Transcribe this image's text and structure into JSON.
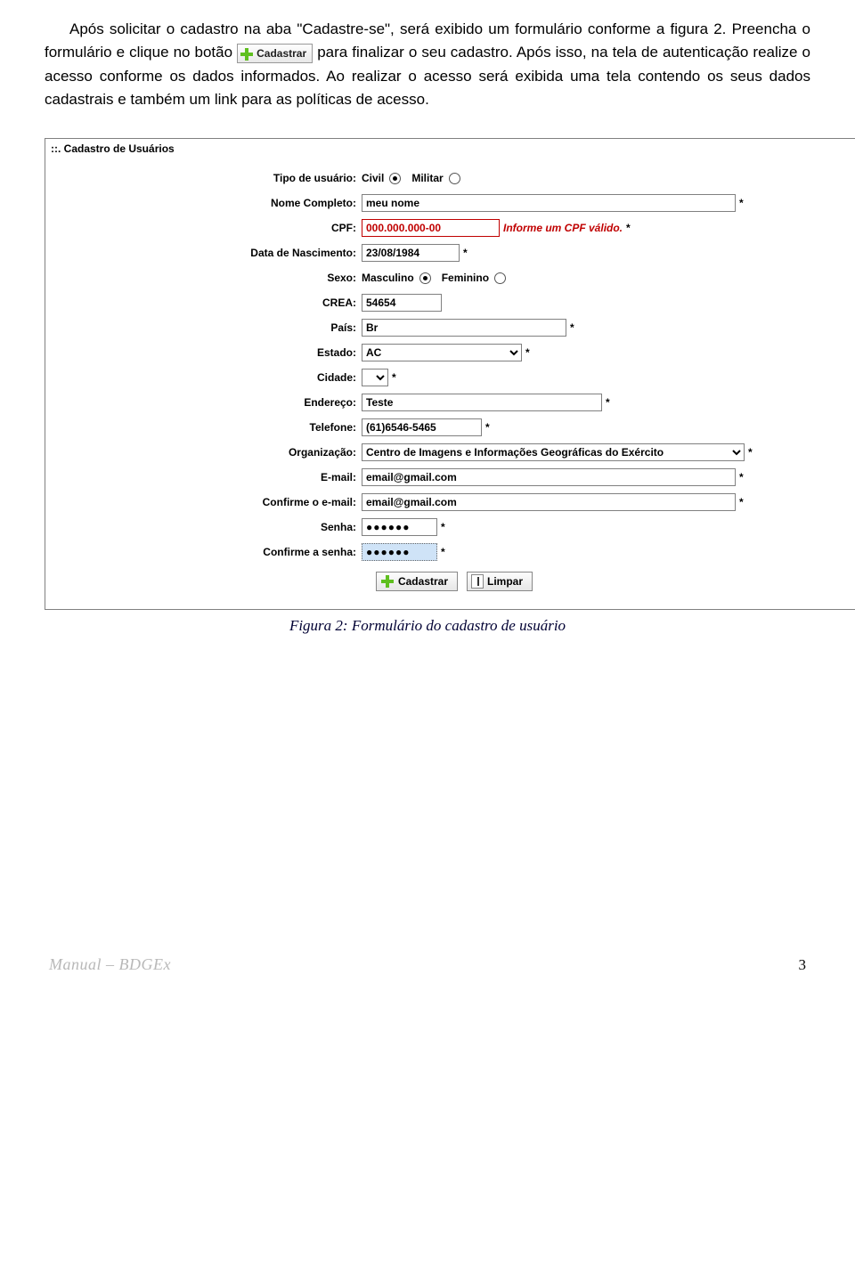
{
  "body": {
    "p1a": "Após solicitar o cadastro na aba \"Cadastre-se\", será exibido um formulário conforme a figura 2. Preencha o formulário e clique no botão ",
    "p1b": " para finalizar o seu cadastro. Após isso, na tela de autenticação realize o acesso conforme os dados informados. Ao realizar o acesso será exibida uma tela contendo os seus dados cadastrais e também um link para as políticas de acesso.",
    "inline_btn": "Cadastrar"
  },
  "panel_title": "::. Cadastro de Usuários",
  "form": {
    "tipo": {
      "label": "Tipo de usuário:",
      "opt1": "Civil",
      "opt2": "Militar",
      "selected": "Civil"
    },
    "nome": {
      "label": "Nome Completo:",
      "value": "meu nome"
    },
    "cpf": {
      "label": "CPF:",
      "value": "000.000.000-00",
      "error": "Informe um CPF válido."
    },
    "nasc": {
      "label": "Data de Nascimento:",
      "value": "23/08/1984"
    },
    "sexo": {
      "label": "Sexo:",
      "opt1": "Masculino",
      "opt2": "Feminino",
      "selected": "Masculino"
    },
    "crea": {
      "label": "CREA:",
      "value": "54654"
    },
    "pais": {
      "label": "País:",
      "value": "Br"
    },
    "estado": {
      "label": "Estado:",
      "value": "AC"
    },
    "cidade": {
      "label": "Cidade:",
      "value": ""
    },
    "endereco": {
      "label": "Endereço:",
      "value": "Teste"
    },
    "telefone": {
      "label": "Telefone:",
      "value": "(61)6546-5465"
    },
    "org": {
      "label": "Organização:",
      "value": "Centro de Imagens e Informações Geográficas do Exército"
    },
    "email": {
      "label": "E-mail:",
      "value": "email@gmail.com"
    },
    "email2": {
      "label": "Confirme o e-mail:",
      "value": "email@gmail.com"
    },
    "senha": {
      "label": "Senha:",
      "value": "●●●●●●"
    },
    "senha2": {
      "label": "Confirme a senha:",
      "value": "●●●●●●"
    }
  },
  "buttons": {
    "cadastrar": "Cadastrar",
    "limpar": "Limpar"
  },
  "caption": "Figura 2: Formulário do cadastro de usuário",
  "footer": {
    "manual": "Manual – BDGEx",
    "page": "3"
  },
  "star": "*"
}
